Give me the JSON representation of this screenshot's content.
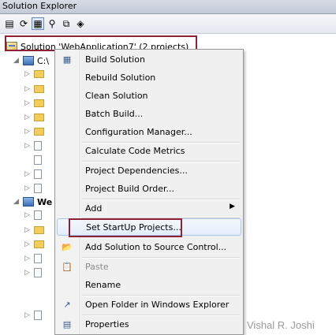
{
  "window": {
    "title": "Solution Explorer"
  },
  "toolbar": {
    "buttons": [
      {
        "icon": "properties-icon",
        "glyph": "▤"
      },
      {
        "icon": "refresh-icon",
        "glyph": "⟳"
      },
      {
        "icon": "show-all-files-icon",
        "glyph": "▦"
      },
      {
        "icon": "view-code-icon",
        "glyph": "⚲"
      },
      {
        "icon": "view-designer-icon",
        "glyph": "⧉"
      },
      {
        "icon": "class-diagram-icon",
        "glyph": "◈"
      }
    ]
  },
  "tree": {
    "solution_label": "Solution 'WebApplication7' (2 projects)",
    "project1_label": "C:\\",
    "project2_label": "We"
  },
  "context_menu": {
    "items": [
      {
        "label": "Build Solution",
        "icon": "build-icon",
        "glyph": "▦"
      },
      {
        "label": "Rebuild Solution"
      },
      {
        "label": "Clean Solution"
      },
      {
        "label": "Batch Build..."
      },
      {
        "label": "Configuration Manager..."
      },
      {
        "label": "Calculate Code Metrics"
      },
      {
        "label": "Project Dependencies..."
      },
      {
        "label": "Project Build Order..."
      },
      {
        "label": "Add",
        "submenu": true
      },
      {
        "label": "Set StartUp Projects..."
      },
      {
        "label": "Add Solution to Source Control...",
        "icon": "source-control-icon",
        "glyph": "📂"
      },
      {
        "label": "Paste",
        "disabled": true,
        "icon": "paste-icon",
        "glyph": "📋"
      },
      {
        "label": "Rename"
      },
      {
        "label": "Open Folder in Windows Explorer",
        "icon": "open-folder-icon",
        "glyph": "↗"
      },
      {
        "label": "Properties",
        "icon": "properties-icon",
        "glyph": "▤"
      }
    ],
    "hover_index": 9
  },
  "watermark": "Vishal R. Joshi",
  "colors": {
    "highlight_border": "#8b2235",
    "menu_hover": "#e3eefb"
  }
}
